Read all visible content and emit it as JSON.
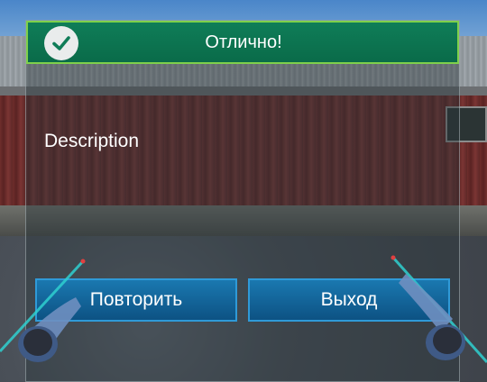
{
  "dialog": {
    "title": "Отлично!",
    "description": "Description",
    "retry_label": "Повторить",
    "exit_label": "Выход"
  },
  "colors": {
    "header_green": "#0f7d58",
    "header_border": "#7fd04b",
    "button_blue": "#1a78b0",
    "laser_cyan": "#2fd0d0"
  },
  "icons": {
    "header": "check-icon"
  }
}
